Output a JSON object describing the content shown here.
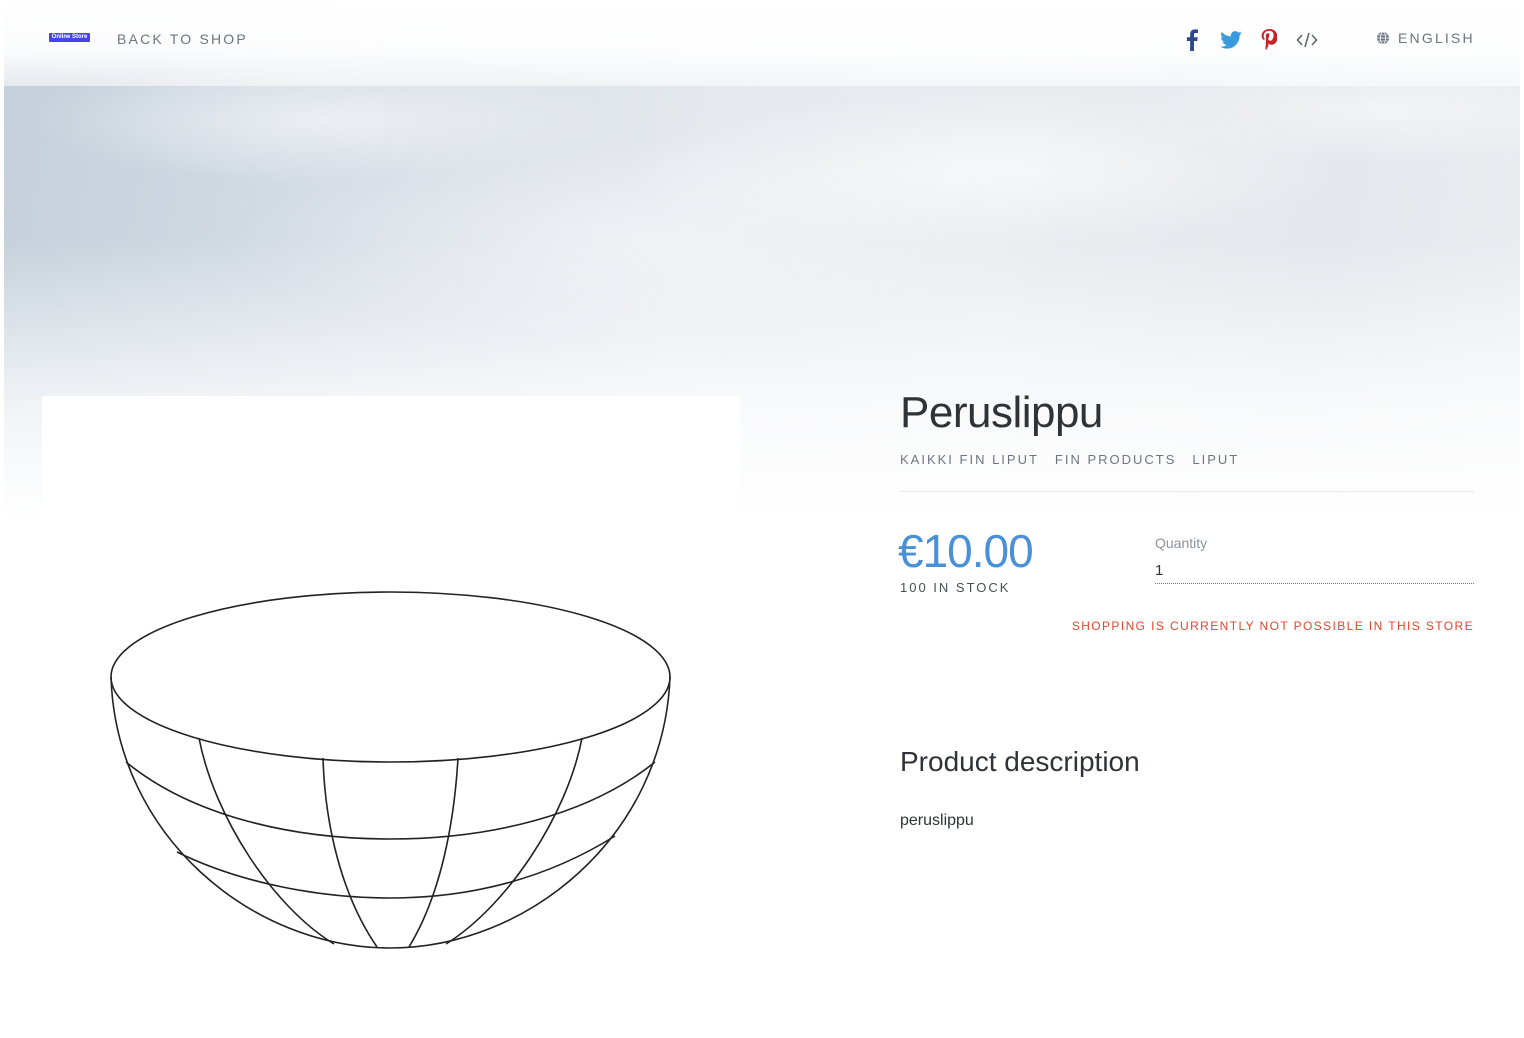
{
  "header": {
    "logo_text": "Online Store",
    "back_label": "BACK TO SHOP",
    "share_icons": [
      "facebook-icon",
      "twitter-icon",
      "pinterest-icon",
      "embed-code-icon"
    ],
    "language_label": "ENGLISH"
  },
  "product": {
    "title": "Peruslippu",
    "categories": [
      "KAIKKI FIN LIPUT",
      "FIN PRODUCTS",
      "LIPUT"
    ],
    "price": "€10.00",
    "stock": "100 IN STOCK",
    "quantity_label": "Quantity",
    "quantity_value": "1",
    "notice": "SHOPPING IS CURRENTLY NOT POSSIBLE IN THIS STORE",
    "description_heading": "Product description",
    "description": "peruslippu",
    "image_icon": "bowl-placeholder-icon"
  },
  "colors": {
    "price": "#4a90d9",
    "notice": "#e8442c",
    "logo": "#4444ee",
    "facebook": "#2d4a8a",
    "twitter": "#3a9bdc",
    "pinterest": "#c8232c"
  }
}
